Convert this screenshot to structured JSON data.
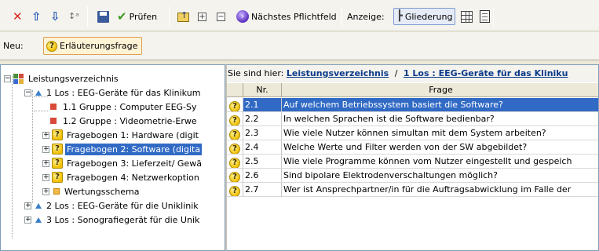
{
  "toolbar": {
    "delete_icon": "red-x-icon",
    "pruefen_label": "Prüfen",
    "naechstes_label": "Nächstes Pflichtfeld",
    "anzeige_label": "Anzeige:",
    "gliederung_label": "Gliederung"
  },
  "newbar": {
    "label": "Neu:",
    "button_label": "Erläuterungsfrage"
  },
  "tree": {
    "root": "Leistungsverzeichnis",
    "items": [
      {
        "label": "1 Los : EEG-Geräte für das Klinikum"
      },
      {
        "label": "1.1 Gruppe : Computer EEG-Sy"
      },
      {
        "label": "1.2 Gruppe : Videometrie-Erwe"
      },
      {
        "label": "Fragebogen 1: Hardware (digit"
      },
      {
        "label": "Fragebogen 2: Software (digita"
      },
      {
        "label": "Fragebogen 3: Lieferzeit/ Gewä"
      },
      {
        "label": "Fragebogen 4: Netzwerkoption"
      },
      {
        "label": "Wertungsschema"
      },
      {
        "label": "2 Los : EEG-Geräte für die Uniklinik"
      },
      {
        "label": "3 Los : Sonografiegerät für die Unik"
      }
    ]
  },
  "breadcrumb": {
    "prefix": "Sie sind hier:",
    "link1": "Leistungsverzeichnis",
    "sep": "/",
    "link2": "1 Los : EEG-Geräte für das Kliniku"
  },
  "grid": {
    "col_nr": "Nr.",
    "col_frage": "Frage",
    "rows": [
      {
        "nr": "2.1",
        "frage": "Auf welchem Betriebssystem basiert die Software?"
      },
      {
        "nr": "2.2",
        "frage": "In welchen Sprachen ist die Software bedienbar?"
      },
      {
        "nr": "2.3",
        "frage": "Wie viele Nutzer können simultan mit dem System arbeiten?"
      },
      {
        "nr": "2.4",
        "frage": "Welche Werte und Filter werden von der SW abgebildet?"
      },
      {
        "nr": "2.5",
        "frage": "Wie viele Programme können vom Nutzer eingestellt und gespeich"
      },
      {
        "nr": "2.6",
        "frage": "Sind bipolare Elektrodenverschaltungen möglich?"
      },
      {
        "nr": "2.7",
        "frage": "Wer ist Ansprechpartner/in für die Auftragsabwicklung im Falle der"
      }
    ]
  },
  "colors": {
    "selection": "#316ac5",
    "link": "#0b3a8a",
    "new_button_border": "#e0a050"
  }
}
